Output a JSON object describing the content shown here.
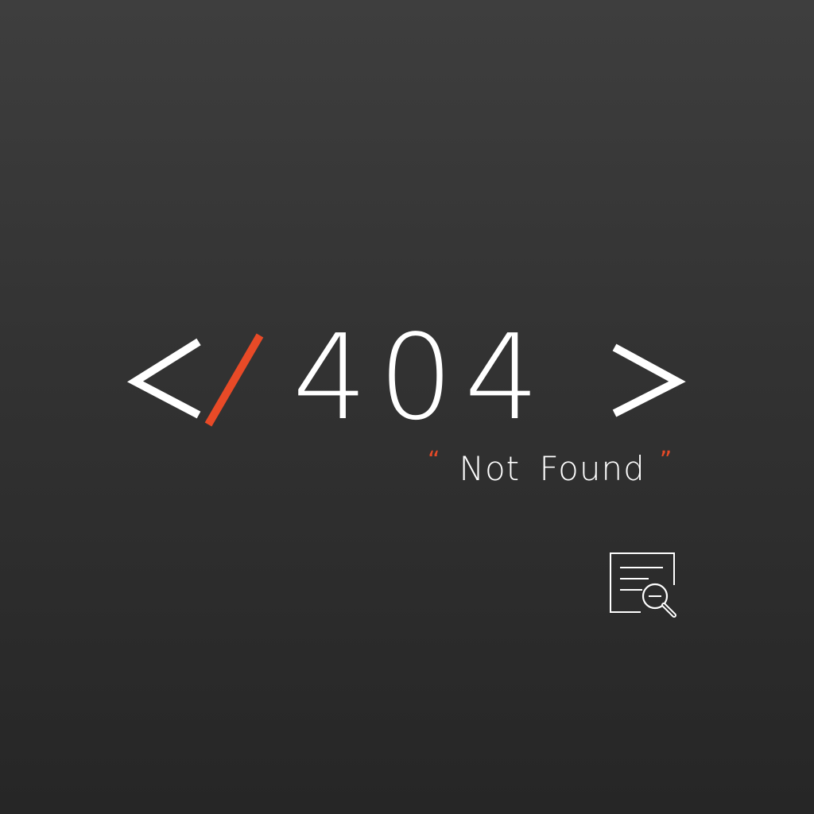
{
  "error": {
    "open_bracket": "<",
    "slash": "/",
    "code": "404",
    "close_bracket": ">",
    "message": "Not Found",
    "open_quote": "“",
    "close_quote": "”"
  },
  "colors": {
    "background_top": "#3e3e3e",
    "background_bottom": "#262626",
    "text": "#ffffff",
    "accent": "#e84a27"
  },
  "icons": {
    "document_search": "document-search-icon"
  }
}
